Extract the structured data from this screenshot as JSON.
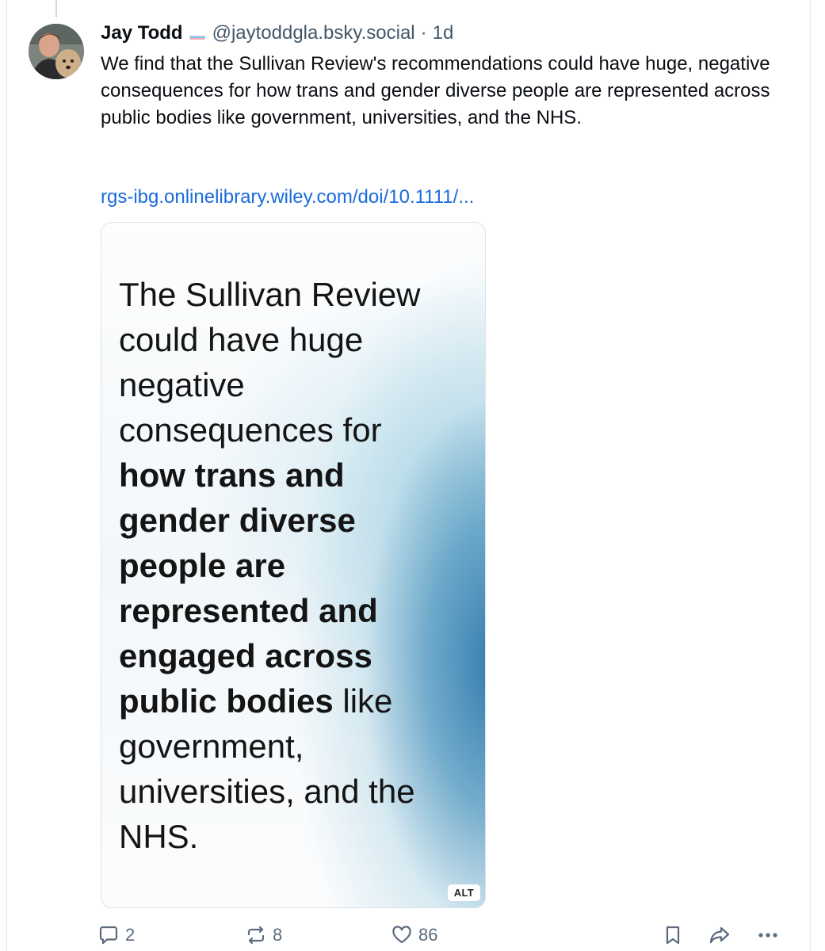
{
  "post": {
    "author_name": "Jay Todd",
    "author_handle": "@jaytoddgla.bsky.social",
    "separator": "·",
    "time": "1d",
    "text": "We find that the Sullivan Review's recommendations could have huge, negative consequences for how trans and gender diverse people are represented across public bodies like government, universities, and the NHS.",
    "link": "rgs-ibg.onlinelibrary.wiley.com/doi/10.1111/..."
  },
  "image": {
    "lines": [
      {
        "text": "The Sullivan Review",
        "bold": false
      },
      {
        "text": "could have huge",
        "bold": false
      },
      {
        "text": "negative",
        "bold": false
      },
      {
        "text": "consequences for",
        "bold": false
      },
      {
        "text": "how trans and",
        "bold": true
      },
      {
        "text": "gender diverse",
        "bold": true
      },
      {
        "text": "people are",
        "bold": true
      },
      {
        "text": "represented and",
        "bold": true
      },
      {
        "text": "engaged across",
        "bold": true
      },
      {
        "text": "public bodies",
        "bold": true,
        "suffix": " like"
      },
      {
        "text": "government,",
        "bold": false
      },
      {
        "text": "universities, and the",
        "bold": false
      },
      {
        "text": "NHS.",
        "bold": false
      }
    ],
    "alt_badge": "ALT"
  },
  "actions": {
    "reply_count": "2",
    "repost_count": "8",
    "like_count": "86"
  },
  "colors": {
    "link": "#1a6bdc",
    "muted": "#42576c",
    "icon": "#5b6b7d",
    "card_accent": "#2674aa"
  },
  "icons": {
    "reply": "speech-bubble-icon",
    "repost": "repost-arrows-icon",
    "like": "heart-icon",
    "bookmark": "bookmark-icon",
    "share": "share-arrow-icon",
    "more": "ellipsis-icon",
    "flag": "transgender-flag-icon"
  }
}
